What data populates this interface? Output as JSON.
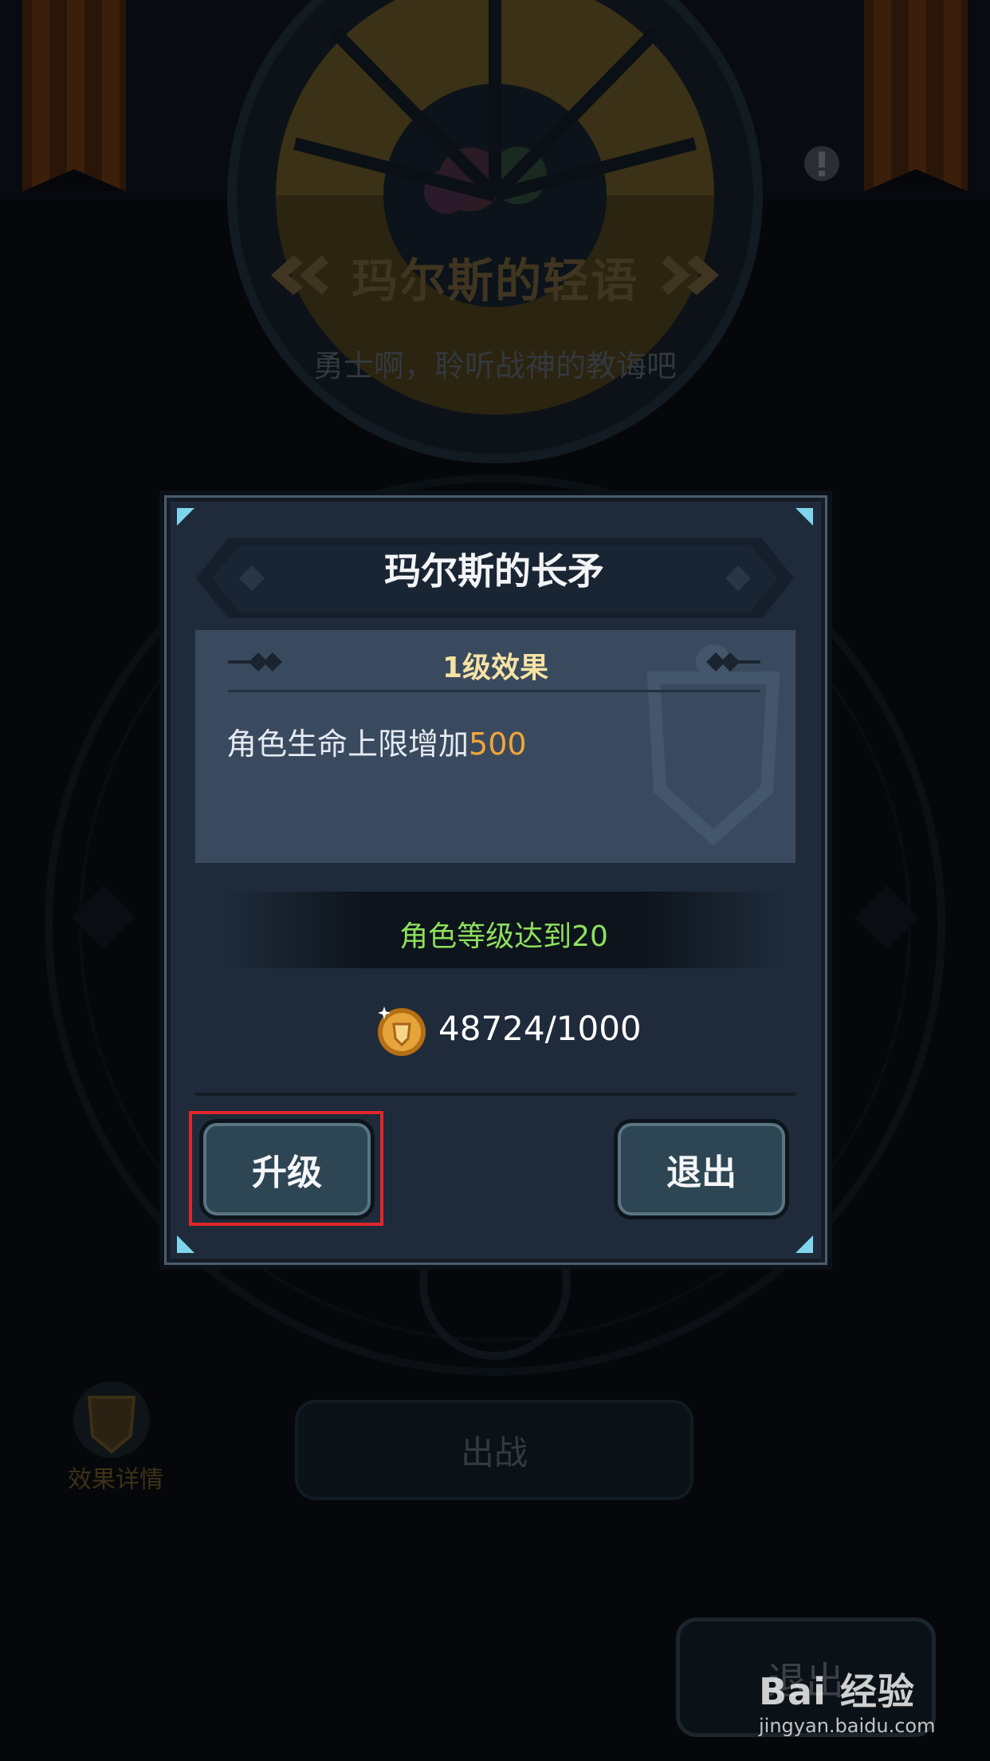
{
  "background": {
    "title": "玛尔斯的轻语",
    "subtitle": "勇士啊，聆听战神的教诲吧",
    "deploy_label": "出战",
    "effect_details_label": "效果详情",
    "exit_label": "退出",
    "info_icon": "exclamation-icon"
  },
  "dialog": {
    "title": "玛尔斯的长矛",
    "effect_header": "1级效果",
    "effect_desc_prefix": "角色生命上限增加",
    "effect_desc_value": "500",
    "requirement": "角色等级达到20",
    "cost": "48724/1000",
    "cost_icon": "coin-icon",
    "upgrade_label": "升级",
    "exit_label": "退出"
  },
  "watermark": {
    "main": "Bai 经验",
    "url": "jingyan.baidu.com"
  },
  "colors": {
    "dialog_bg": "#1f2b3a",
    "effect_box": "#3a4a5e",
    "highlight_value": "#f2a53a",
    "requirement_green": "#8fe05c",
    "effect_header_gold": "#f5e3a4",
    "highlight_border": "#e0262a"
  }
}
